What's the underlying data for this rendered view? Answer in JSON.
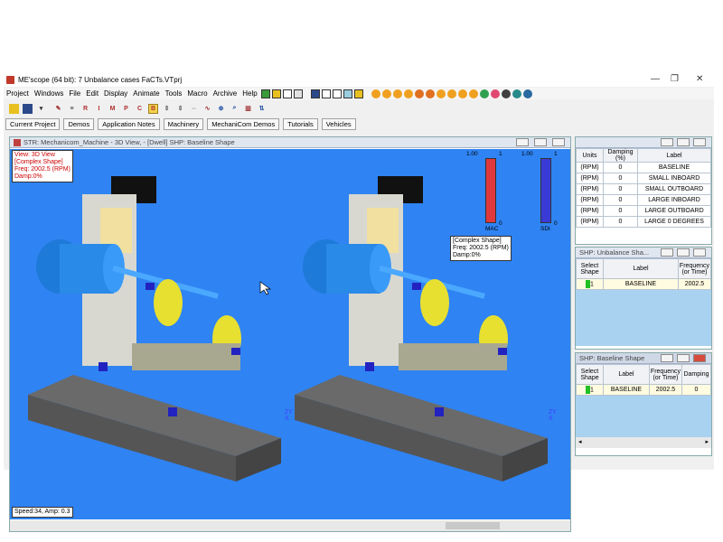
{
  "window": {
    "title": "ME'scope (64 bit): 7 Unbalance cases FaCTs.VTprj",
    "controls": [
      "—",
      "❐",
      "✕"
    ]
  },
  "menu": [
    "Project",
    "Windows",
    "File",
    "Edit",
    "Display",
    "Animate",
    "Tools",
    "Macro",
    "Archive",
    "Help"
  ],
  "toolbar_letters": [
    "R",
    "I",
    "M",
    "P",
    "C",
    "B"
  ],
  "project_tabs": [
    "Current Project",
    "Demos",
    "Application Notes",
    "Machinery",
    "MechaniCom Demos",
    "Tutorials",
    "Vehicles"
  ],
  "view3d": {
    "title": "STR: Mechanicom_Machine - 3D View,  - [Dwell] SHP: Baseline Shape",
    "label_box": [
      "View: 3D View",
      "[Complex Shape]",
      "Freq: 2002.5 (RPM)",
      "Damp:0%"
    ],
    "right_box": [
      "[Complex Shape]",
      "Freq: 2002.5 (RPM)",
      "Damp:0%"
    ],
    "mac_bar": {
      "label": "MAC",
      "top": "1.00",
      "top_right": "1",
      "bottom": "0",
      "level": 1.0,
      "color": "#e0393c"
    },
    "sdi_bar": {
      "label": "SDI",
      "top": "1.00",
      "top_right": "1",
      "bottom": "0",
      "level": 1.0,
      "color": "#3a3ad6"
    },
    "status": "Speed:34, Amp: 0.3",
    "axes": {
      "z": "Z",
      "y": "Y",
      "x": "X"
    }
  },
  "units_panel": {
    "headers": [
      "Units",
      "Damping (%)",
      "Label"
    ],
    "rows": [
      {
        "units": "(RPM)",
        "damping": "0",
        "label": "BASELINE"
      },
      {
        "units": "(RPM)",
        "damping": "0",
        "label": "SMALL INBOARD"
      },
      {
        "units": "(RPM)",
        "damping": "0",
        "label": "SMALL OUTBOARD"
      },
      {
        "units": "(RPM)",
        "damping": "0",
        "label": "LARGE INBOARD"
      },
      {
        "units": "(RPM)",
        "damping": "0",
        "label": "LARGE OUTBOARD"
      },
      {
        "units": "(RPM)",
        "damping": "0",
        "label": "LARGE 0 DEGREES"
      }
    ]
  },
  "unbalance_panel": {
    "title": "SHP: Unbalance Sha...",
    "headers": [
      "Select Shape",
      "Label",
      "Frequency (or Time)"
    ],
    "rows": [
      {
        "select": "1",
        "label": "BASELINE",
        "freq": "2002.5"
      }
    ]
  },
  "baseline_panel": {
    "title": "SHP: Baseline Shape",
    "headers": [
      "Select Shape",
      "Label",
      "Frequency (or Time)",
      "Damping"
    ],
    "rows": [
      {
        "select": "1",
        "label": "BASELINE",
        "freq": "2002.5",
        "damping": "0"
      }
    ]
  },
  "colors": {
    "viewport_bg": "#2f83f2",
    "select_green": "#22c022"
  }
}
